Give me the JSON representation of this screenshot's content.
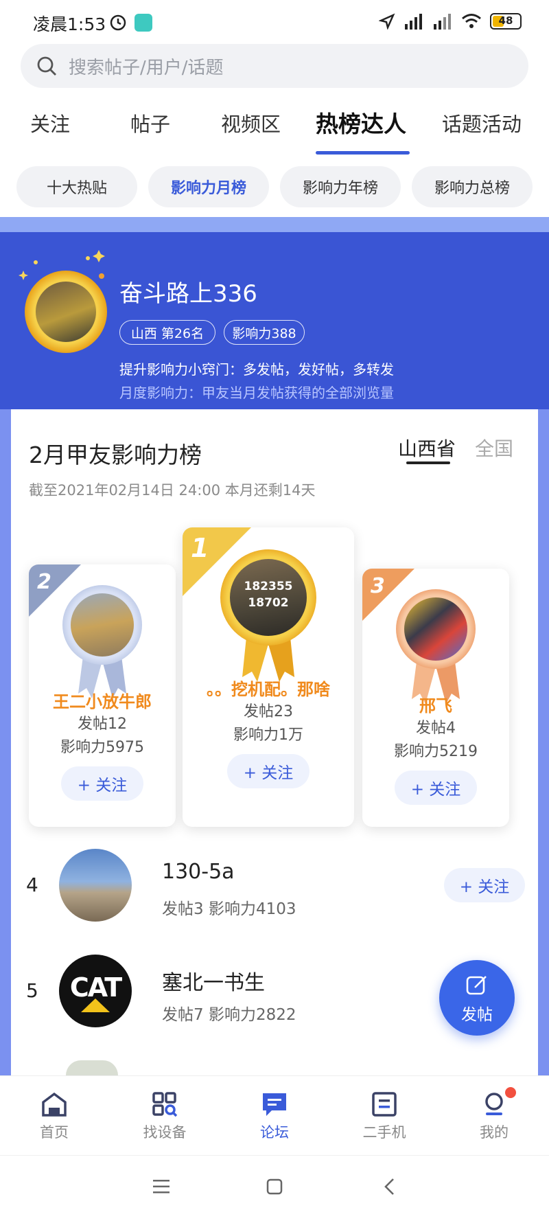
{
  "status_bar": {
    "time": "凌晨1:53",
    "battery": "48"
  },
  "search": {
    "placeholder": "搜索帖子/用户/话题"
  },
  "main_tabs": [
    {
      "label": "关注"
    },
    {
      "label": "帖子"
    },
    {
      "label": "视频区"
    },
    {
      "label": "热榜达人",
      "active": true
    },
    {
      "label": "话题活动"
    }
  ],
  "sub_tabs": [
    {
      "label": "十大热贴"
    },
    {
      "label": "影响力月榜",
      "active": true
    },
    {
      "label": "影响力年榜"
    },
    {
      "label": "影响力总榜"
    }
  ],
  "me": {
    "name": "奋斗路上336",
    "rank_badge": "山西  第26名",
    "influence_badge": "影响力388",
    "tip": "提升影响力小窍门：多发帖，发好帖，多转发",
    "desc": "月度影响力：甲友当月发帖获得的全部浏览量"
  },
  "ranking": {
    "title": "2月甲友影响力榜",
    "subtitle": "截至2021年02月14日 24:00 本月还剩14天",
    "region_selected": "山西省",
    "region_other": "全国",
    "follow_label": "+ 关注",
    "podium": [
      {
        "rank": "1",
        "name": "。。挖机配。那啥",
        "posts": "发帖23",
        "influence": "影响力1万",
        "medal_text_1": "182355",
        "medal_text_2": "18702"
      },
      {
        "rank": "2",
        "name": "王二小放牛郎",
        "posts": "发帖12",
        "influence": "影响力5975"
      },
      {
        "rank": "3",
        "name": "邢飞",
        "posts": "发帖4",
        "influence": "影响力5219"
      }
    ],
    "list": [
      {
        "rank": "4",
        "name": "130-5a",
        "stats": "发帖3   影响力4103"
      },
      {
        "rank": "5",
        "name": "塞北一书生",
        "stats": "发帖7   影响力2822",
        "avatar_text": "CAT"
      }
    ]
  },
  "fab": {
    "label": "发帖"
  },
  "bottom_nav": [
    {
      "label": "首页",
      "icon": "home-icon"
    },
    {
      "label": "找设备",
      "icon": "find-device-icon"
    },
    {
      "label": "论坛",
      "icon": "forum-icon",
      "active": true
    },
    {
      "label": "二手机",
      "icon": "used-machine-icon"
    },
    {
      "label": "我的",
      "icon": "profile-icon"
    }
  ],
  "colors": {
    "accent": "#3a5bd9",
    "hero_bg": "#3a55d4",
    "gold": "#f08a1d",
    "fab": "#3a66e8"
  }
}
